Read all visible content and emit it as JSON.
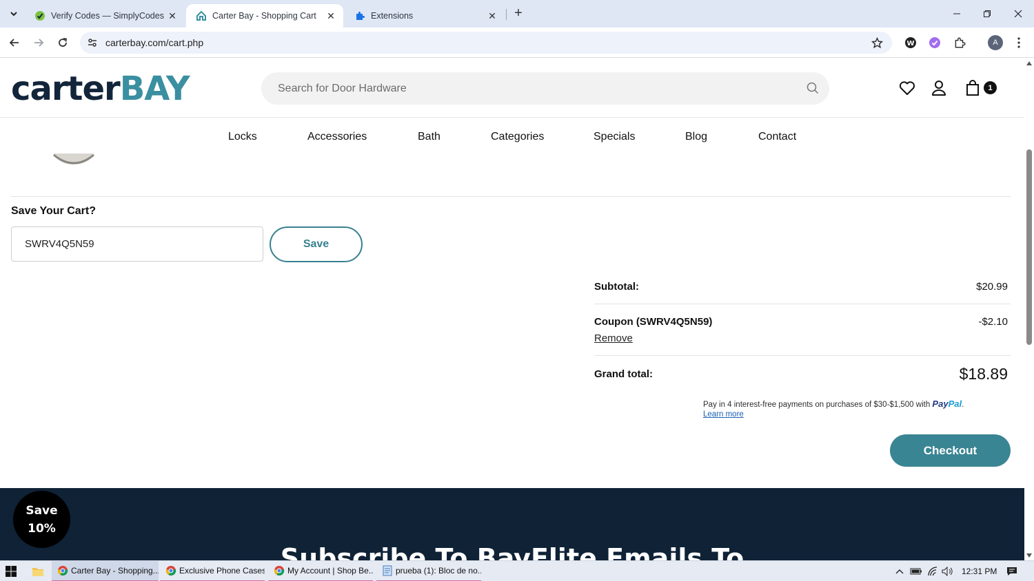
{
  "browser": {
    "tabs": [
      {
        "title": "Verify Codes — SimplyCodes",
        "active": false
      },
      {
        "title": "Carter Bay - Shopping Cart",
        "active": true
      },
      {
        "title": "Extensions",
        "active": false
      }
    ],
    "url": "carterbay.com/cart.php",
    "profile_initial": "A"
  },
  "site": {
    "logo_part1": "carter",
    "logo_part2": "BAY",
    "search_placeholder": "Search for Door Hardware",
    "cart_count": "1",
    "nav": [
      "Locks",
      "Accessories",
      "Bath",
      "Categories",
      "Specials",
      "Blog",
      "Contact"
    ]
  },
  "save_cart": {
    "title": "Save Your Cart?",
    "code_value": "SWRV4Q5N59",
    "button_label": "Save"
  },
  "totals": {
    "subtotal_label": "Subtotal:",
    "subtotal_value": "$20.99",
    "coupon_label": "Coupon (SWRV4Q5N59)",
    "coupon_value": "-$2.10",
    "remove_label": "Remove",
    "grand_label": "Grand total:",
    "grand_value": "$18.89"
  },
  "paypal": {
    "message": "Pay in 4 interest-free payments on purchases of $30-$1,500 with",
    "logo_a": "Pay",
    "logo_b": "Pal",
    "learn_more": "Learn more"
  },
  "checkout_label": "Checkout",
  "footer_headline": "Subscribe To BayElite Emails To",
  "promo_bubble": {
    "line1": "Save",
    "line2": "10%"
  },
  "taskbar": {
    "apps": [
      "Carter Bay - Shopping...",
      "Exclusive Phone Cases...",
      "My Account | Shop Be...",
      "prueba (1): Bloc de no..."
    ],
    "time": "12:31 PM"
  },
  "colors": {
    "brand_navy": "#13253b",
    "brand_teal": "#3a8fa0",
    "checkout_bg": "#3a8593",
    "footer_bg": "#0f2236"
  }
}
